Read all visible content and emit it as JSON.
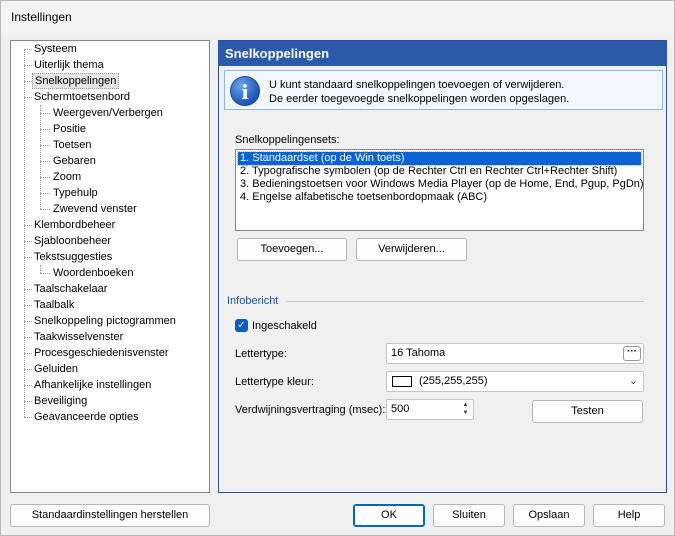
{
  "window": {
    "title": "Instellingen"
  },
  "tree": {
    "items": [
      "Systeem",
      "Uiterlijk thema",
      "Snelkoppelingen",
      "Schermtoetsenbord",
      "Weergeven/Verbergen",
      "Positie",
      "Toetsen",
      "Gebaren",
      "Zoom",
      "Typehulp",
      "Zwevend venster",
      "Klembordbeheer",
      "Sjabloonbeheer",
      "Tekstsuggesties",
      "Woordenboeken",
      "Taalschakelaar",
      "Taalbalk",
      "Snelkoppeling pictogrammen",
      "Taakwisselvenster",
      "Procesgeschiedenisvenster",
      "Geluiden",
      "Afhankelijke instellingen",
      "Beveiliging",
      "Geavanceerde opties"
    ],
    "selected": "Snelkoppelingen"
  },
  "panel": {
    "header": "Snelkoppelingen",
    "info_line1": "U kunt standaard snelkoppelingen toevoegen of verwijderen.",
    "info_line2": "De eerder toegevoegde snelkoppelingen worden opgeslagen.",
    "sets_label": "Snelkoppelingensets:",
    "sets": [
      "1. Standaardset (op de Win toets)",
      "2. Typografische symbolen (op de Rechter Ctrl en Rechter Ctrl+Rechter Shift)",
      "3. Bedieningstoetsen voor Windows Media Player (op de Home, End, Pgup, PgDn)",
      "4. Engelse alfabetische toetsenbordopmaak (ABC)"
    ],
    "add_button": "Toevoegen...",
    "remove_button": "Verwijderen...",
    "group_title": "Infobericht",
    "enabled_label": "Ingeschakeld",
    "enabled_checked": true,
    "font_label": "Lettertype:",
    "font_value": "16 Tahoma",
    "font_color_label": "Lettertype kleur:",
    "font_color_value": "(255,255,255)",
    "delay_label": "Verdwijningsvertraging (msec):",
    "delay_value": "500",
    "test_button": "Testen"
  },
  "footer": {
    "reset_button": "Standaardinstellingen herstellen",
    "ok_button": "OK",
    "close_button": "Sluiten",
    "save_button": "Opslaan",
    "help_button": "Help"
  },
  "colors": {
    "accent": "#2b5aab",
    "selection": "#0a63d6"
  },
  "icons": {
    "info": "info-icon",
    "ellipsis": "ellipsis-icon",
    "dropdown": "chevron-down-icon",
    "spinner": "spinner-arrows-icon",
    "check": "checkmark-icon"
  }
}
